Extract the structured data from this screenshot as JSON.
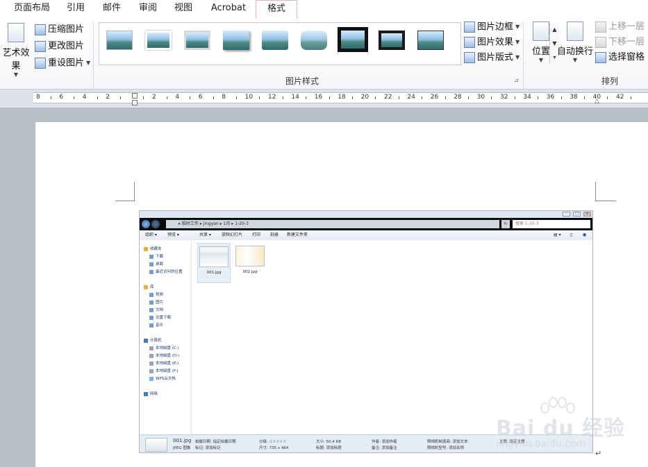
{
  "tabs": [
    "页面布局",
    "引用",
    "邮件",
    "审阅",
    "视图",
    "Acrobat",
    "格式"
  ],
  "active_tab": "格式",
  "ribbon": {
    "adjust": {
      "art_effects_label": "艺术效果",
      "compress_label": "压缩图片",
      "change_label": "更改图片",
      "reset_label": "重设图片"
    },
    "styles": {
      "group_label": "图片样式",
      "border_label": "图片边框",
      "effects_label": "图片效果",
      "layout_label": "图片版式"
    },
    "arrange": {
      "group_label": "排列",
      "position_label": "位置",
      "wrap_label": "自动换行",
      "bring_forward_label": "上移一层",
      "send_backward_label": "下移一层",
      "selection_pane_label": "选择窗格"
    }
  },
  "ruler": {
    "labels": [
      "8",
      "6",
      "4",
      "2",
      "",
      "2",
      "4",
      "6",
      "8",
      "10",
      "12",
      "14",
      "16",
      "18",
      "20",
      "22",
      "24",
      "26",
      "28",
      "30",
      "32",
      "34",
      "36",
      "38",
      "40",
      "42"
    ]
  },
  "explorer": {
    "breadcrumb": "▸ 临时工作 ▸ jingyan ▸ 1月 ▸ 1-20-3",
    "search_placeholder": "搜索 1-20-3",
    "toolbar": [
      "组织 ▾",
      "预览 ▾",
      "共享 ▾",
      "放映幻灯片",
      "打印",
      "刻录",
      "新建文件夹"
    ],
    "nav": {
      "favorites": "收藏夹",
      "favorites_items": [
        "下载",
        "桌面",
        "最近访问的位置"
      ],
      "libraries": "库",
      "library_items": [
        "视频",
        "图片",
        "文档",
        "迅雷下载",
        "音乐"
      ],
      "computer": "计算机",
      "computer_items": [
        "本地磁盘 (C:)",
        "本地磁盘 (D:)",
        "本地磁盘 (E:)",
        "本地磁盘 (F:)",
        "WPS云文档"
      ],
      "network": "网络"
    },
    "files": [
      "001.jpg",
      "002.jpg"
    ],
    "details": {
      "name": "001.jpg",
      "type": "JPEG 图像",
      "date_taken": "拍摄日期: 指定拍摄日期",
      "tags": "标记: 添加标记",
      "rating": "分级: ☆☆☆☆☆",
      "dimensions": "尺寸: 735 x 464",
      "size": "大小: 50.4 KB",
      "title": "标题: 添加标题",
      "author": "作者: 添加作者",
      "comments": "备注: 添加备注",
      "camera_maker": "照相机制造商: 添加文本",
      "camera_model": "照相机型号: 添加名称",
      "subject": "主题: 指定主题"
    }
  },
  "watermark": {
    "brand": "Bai du 经验",
    "url": "jingyan.baidu.com"
  },
  "paragraph_mark": "↵"
}
